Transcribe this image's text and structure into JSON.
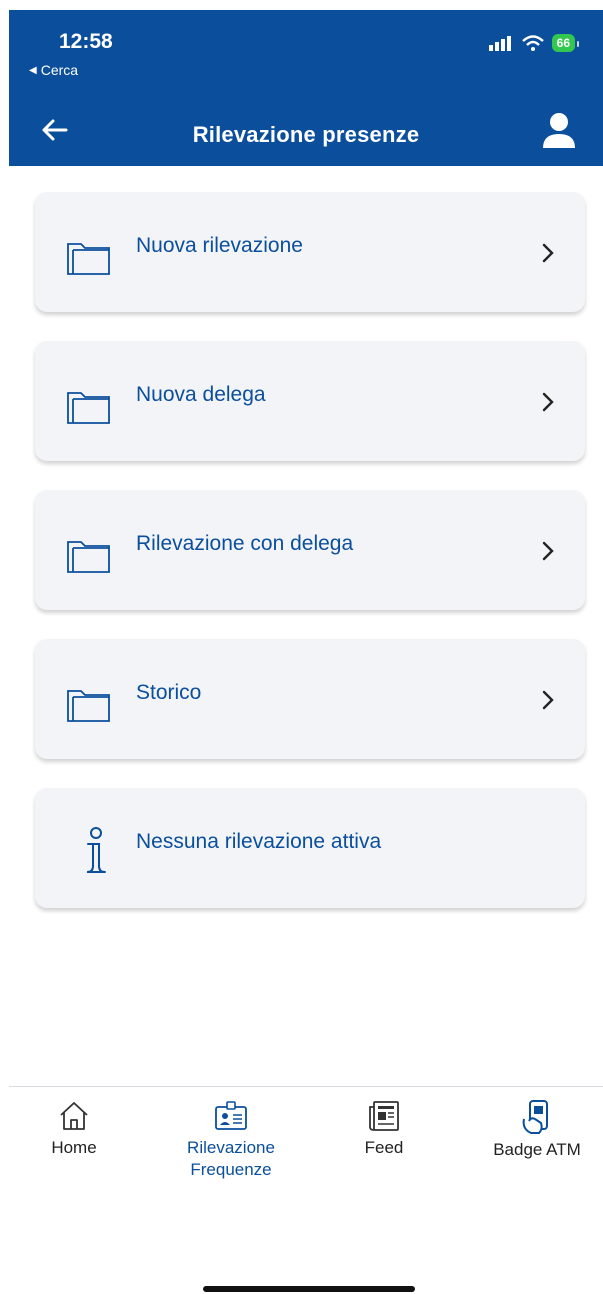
{
  "status_bar": {
    "time": "12:58",
    "back_label": "Cerca",
    "battery": "66"
  },
  "nav": {
    "title": "Rilevazione presenze",
    "back_icon": "arrow-left-icon",
    "user_icon": "user-icon"
  },
  "menu": {
    "items": [
      {
        "label": "Nuova rilevazione",
        "icon": "folder-icon"
      },
      {
        "label": "Nuova delega",
        "icon": "folder-icon"
      },
      {
        "label": "Rilevazione con delega",
        "icon": "folder-icon"
      },
      {
        "label": "Storico",
        "icon": "folder-icon"
      }
    ],
    "info": {
      "label": "Nessuna rilevazione attiva",
      "icon": "info-icon"
    }
  },
  "tabbar": {
    "tabs": [
      {
        "label": "Home",
        "icon": "home-icon"
      },
      {
        "label": "Rilevazione\nFrequenze",
        "label_line1": "Rilevazione",
        "label_line2": "Frequenze",
        "icon": "id-badge-icon",
        "active": true
      },
      {
        "label": "Feed",
        "icon": "newspaper-icon"
      },
      {
        "label": "Badge ATM",
        "icon": "phone-badge-icon"
      }
    ]
  },
  "colors": {
    "brand": "#0b4f9c",
    "card": "#f3f4f7",
    "battery": "#32c850"
  }
}
